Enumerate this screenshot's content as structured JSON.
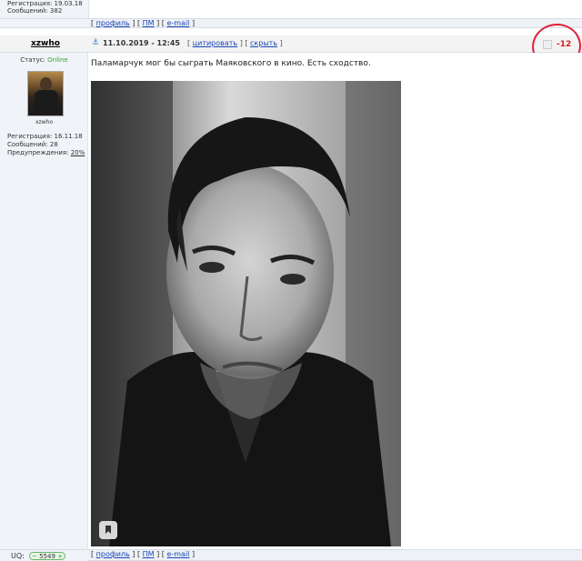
{
  "prev_post": {
    "reg_label": "Регистрация: 19.03.18",
    "msgs_label": "Сообщений: 382"
  },
  "links": {
    "open": "[",
    "sep": "] [",
    "close": "]",
    "profile": "профиль",
    "pm": "ПМ",
    "email": "e-mail"
  },
  "post": {
    "author": "xzwho",
    "date": "11.10.2019 - 12:45",
    "quote": "цитировать",
    "hide": "скрыть",
    "rating": "-12",
    "text": "Паламарчук мог бы сыграть Маяковского в кино. Есть сходство."
  },
  "user": {
    "status_label": "Статус:",
    "status_value": "Online",
    "avatar_caption": "xzwho",
    "reg": "Регистрация: 16.11.18",
    "msgs": "Сообщений: 28",
    "warn_label": "Предупреждения:",
    "warn_value": "20%"
  },
  "footer": {
    "uq_label": "UQ:",
    "uq_value": "5549"
  },
  "colors": {
    "link": "#1a47b8",
    "online": "#3aa23a",
    "rating": "#d41b1b",
    "annotation": "#e0203a"
  },
  "icons": {
    "post_icon": "anchor-icon",
    "rating_icon": "rating-box-icon",
    "pin_icon": "bookmark-icon"
  }
}
